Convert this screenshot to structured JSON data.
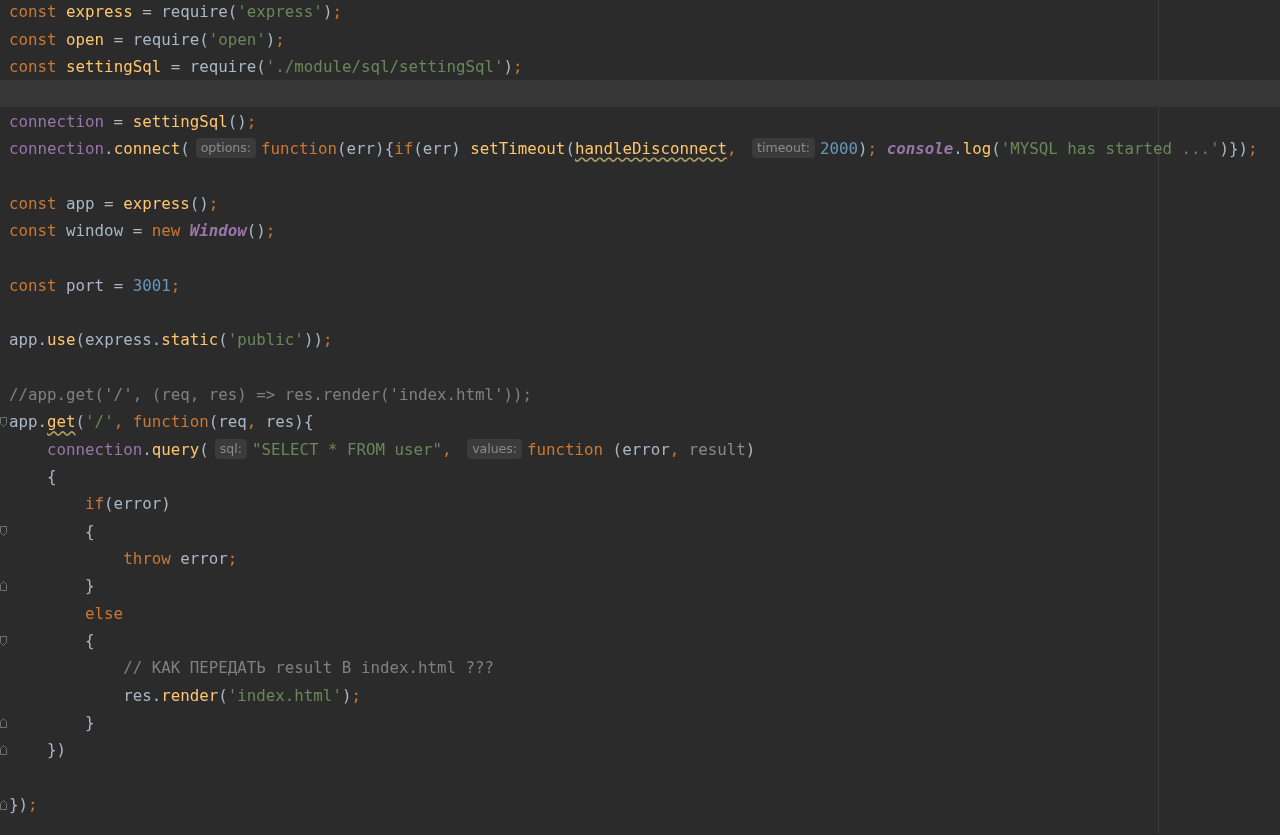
{
  "editor": {
    "lines": [
      {
        "kind": "code",
        "tokens": [
          {
            "kind": "kw",
            "text": "const "
          },
          {
            "kind": "fn",
            "text": "express"
          },
          {
            "kind": "pl",
            "text": " = require("
          },
          {
            "kind": "str",
            "text": "'express'"
          },
          {
            "kind": "pl",
            "text": ")"
          },
          {
            "kind": "kw",
            "text": ";"
          }
        ]
      },
      {
        "kind": "code",
        "tokens": [
          {
            "kind": "kw",
            "text": "const "
          },
          {
            "kind": "fn",
            "text": "open"
          },
          {
            "kind": "pl",
            "text": " = require("
          },
          {
            "kind": "str",
            "text": "'open'"
          },
          {
            "kind": "pl",
            "text": ")"
          },
          {
            "kind": "kw",
            "text": ";"
          }
        ]
      },
      {
        "kind": "code",
        "tokens": [
          {
            "kind": "kw",
            "text": "const "
          },
          {
            "kind": "fn",
            "text": "settingSql"
          },
          {
            "kind": "pl",
            "text": " = require("
          },
          {
            "kind": "str",
            "text": "'./module/sql/settingSql'"
          },
          {
            "kind": "pl",
            "text": ")"
          },
          {
            "kind": "kw",
            "text": ";"
          }
        ]
      },
      {
        "kind": "blank",
        "current": true
      },
      {
        "kind": "code",
        "tokens": [
          {
            "kind": "gl",
            "text": "connection"
          },
          {
            "kind": "pl",
            "text": " = "
          },
          {
            "kind": "fn",
            "text": "settingSql"
          },
          {
            "kind": "pl",
            "text": "()"
          },
          {
            "kind": "kw",
            "text": ";"
          }
        ]
      },
      {
        "kind": "code",
        "tokens": [
          {
            "kind": "gl",
            "text": "connection"
          },
          {
            "kind": "pl",
            "text": "."
          },
          {
            "kind": "fn",
            "text": "connect"
          },
          {
            "kind": "pl",
            "text": "("
          },
          {
            "kind": "hint",
            "text": "options:"
          },
          {
            "kind": "kw",
            "text": "function"
          },
          {
            "kind": "pl",
            "text": "(err){"
          },
          {
            "kind": "kw",
            "text": "if"
          },
          {
            "kind": "pl",
            "text": "(err) "
          },
          {
            "kind": "fn",
            "text": "setTimeout"
          },
          {
            "kind": "pl",
            "text": "("
          },
          {
            "kind": "warn",
            "text": "handleDisconnect"
          },
          {
            "kind": "kw",
            "text": ", "
          },
          {
            "kind": "hint",
            "text": "timeout:"
          },
          {
            "kind": "num",
            "text": "2000"
          },
          {
            "kind": "pl",
            "text": ")"
          },
          {
            "kind": "kw",
            "text": "; "
          },
          {
            "kind": "cls",
            "text": "console"
          },
          {
            "kind": "pl",
            "text": "."
          },
          {
            "kind": "fn",
            "text": "log"
          },
          {
            "kind": "pl",
            "text": "("
          },
          {
            "kind": "str",
            "text": "'MYSQL has started ...'"
          },
          {
            "kind": "pl",
            "text": ")})"
          },
          {
            "kind": "kw",
            "text": ";"
          }
        ]
      },
      {
        "kind": "blank"
      },
      {
        "kind": "code",
        "tokens": [
          {
            "kind": "kw",
            "text": "const "
          },
          {
            "kind": "pl",
            "text": "app = "
          },
          {
            "kind": "fn",
            "text": "express"
          },
          {
            "kind": "pl",
            "text": "()"
          },
          {
            "kind": "kw",
            "text": ";"
          }
        ]
      },
      {
        "kind": "code",
        "tokens": [
          {
            "kind": "kw",
            "text": "const "
          },
          {
            "kind": "pl",
            "text": "window = "
          },
          {
            "kind": "kw",
            "text": "new "
          },
          {
            "kind": "cls",
            "text": "Window"
          },
          {
            "kind": "pl",
            "text": "()"
          },
          {
            "kind": "kw",
            "text": ";"
          }
        ]
      },
      {
        "kind": "blank"
      },
      {
        "kind": "code",
        "tokens": [
          {
            "kind": "kw",
            "text": "const "
          },
          {
            "kind": "pl",
            "text": "port = "
          },
          {
            "kind": "num",
            "text": "3001"
          },
          {
            "kind": "kw",
            "text": ";"
          }
        ]
      },
      {
        "kind": "blank"
      },
      {
        "kind": "code",
        "tokens": [
          {
            "kind": "pl",
            "text": "app."
          },
          {
            "kind": "fn",
            "text": "use"
          },
          {
            "kind": "pl",
            "text": "(express."
          },
          {
            "kind": "fn",
            "text": "static"
          },
          {
            "kind": "pl",
            "text": "("
          },
          {
            "kind": "str",
            "text": "'public'"
          },
          {
            "kind": "pl",
            "text": "))"
          },
          {
            "kind": "kw",
            "text": ";"
          }
        ]
      },
      {
        "kind": "blank"
      },
      {
        "kind": "code",
        "tokens": [
          {
            "kind": "cm",
            "text": "//app.get('/', (req, res) => res.render('index.html'));"
          }
        ]
      },
      {
        "kind": "code",
        "fold_start": true,
        "tokens": [
          {
            "kind": "pl",
            "text": "app."
          },
          {
            "kind": "warn",
            "text": "get"
          },
          {
            "kind": "pl",
            "text": "("
          },
          {
            "kind": "str",
            "text": "'/'"
          },
          {
            "kind": "kw",
            "text": ", function"
          },
          {
            "kind": "pl",
            "text": "(req"
          },
          {
            "kind": "kw",
            "text": ","
          },
          {
            "kind": "pl",
            "text": " res){"
          }
        ]
      },
      {
        "kind": "code",
        "tokens": [
          {
            "kind": "gl",
            "text": "    connection"
          },
          {
            "kind": "pl",
            "text": "."
          },
          {
            "kind": "fn",
            "text": "query"
          },
          {
            "kind": "pl",
            "text": "("
          },
          {
            "kind": "hint",
            "text": "sql:"
          },
          {
            "kind": "str",
            "text": "\"SELECT * FROM user\""
          },
          {
            "kind": "kw",
            "text": ", "
          },
          {
            "kind": "hint",
            "text": "values:"
          },
          {
            "kind": "kw",
            "text": "function"
          },
          {
            "kind": "pl",
            "text": " (error"
          },
          {
            "kind": "kw",
            "text": ","
          },
          {
            "kind": "prm",
            "text": " result"
          },
          {
            "kind": "pl",
            "text": ")"
          }
        ]
      },
      {
        "kind": "code",
        "tokens": [
          {
            "kind": "pl",
            "text": "    {"
          }
        ]
      },
      {
        "kind": "code",
        "tokens": [
          {
            "kind": "kw",
            "text": "        if"
          },
          {
            "kind": "pl",
            "text": "(error)"
          }
        ]
      },
      {
        "kind": "code",
        "fold_start": true,
        "tokens": [
          {
            "kind": "pl",
            "text": "        {"
          }
        ]
      },
      {
        "kind": "code",
        "tokens": [
          {
            "kind": "kw",
            "text": "            throw"
          },
          {
            "kind": "pl",
            "text": " error"
          },
          {
            "kind": "kw",
            "text": ";"
          }
        ]
      },
      {
        "kind": "code",
        "fold_end": true,
        "tokens": [
          {
            "kind": "pl",
            "text": "        }"
          }
        ]
      },
      {
        "kind": "code",
        "tokens": [
          {
            "kind": "kw",
            "text": "        else"
          }
        ]
      },
      {
        "kind": "code",
        "fold_start": true,
        "tokens": [
          {
            "kind": "pl",
            "text": "        {"
          }
        ]
      },
      {
        "kind": "code",
        "tokens": [
          {
            "kind": "cm",
            "text": "            // КАК ПЕРЕДАТЬ result В index.html ???"
          }
        ]
      },
      {
        "kind": "code",
        "tokens": [
          {
            "kind": "pl",
            "text": "            res."
          },
          {
            "kind": "fn",
            "text": "render"
          },
          {
            "kind": "pl",
            "text": "("
          },
          {
            "kind": "str",
            "text": "'index.html'"
          },
          {
            "kind": "pl",
            "text": ")"
          },
          {
            "kind": "kw",
            "text": ";"
          }
        ]
      },
      {
        "kind": "code",
        "fold_end": true,
        "tokens": [
          {
            "kind": "pl",
            "text": "        }"
          }
        ]
      },
      {
        "kind": "code",
        "fold_end": true,
        "tokens": [
          {
            "kind": "pl",
            "text": "    })"
          }
        ]
      },
      {
        "kind": "blank"
      },
      {
        "kind": "code",
        "fold_end": true,
        "tokens": [
          {
            "kind": "pl",
            "text": "})"
          },
          {
            "kind": "kw",
            "text": ";"
          }
        ]
      }
    ]
  }
}
